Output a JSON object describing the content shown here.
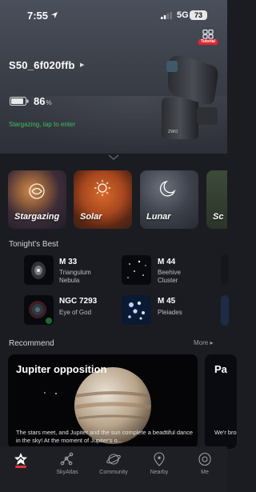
{
  "status_bar": {
    "time": "7:55",
    "network": "5G",
    "battery": "73"
  },
  "header": {
    "tutorial_label": "Tutorial",
    "device_name": "S50_6f020ffb",
    "battery_percent": "86",
    "battery_unit": "%",
    "enter_hint": "Stargazing, tap to enter"
  },
  "modes": [
    {
      "label": "Stargazing"
    },
    {
      "label": "Solar"
    },
    {
      "label": "Lunar"
    },
    {
      "label": "Sc"
    }
  ],
  "tonights_best": {
    "title": "Tonight's Best",
    "objects": [
      {
        "name": "M 33",
        "desc": [
          "Triangulum",
          "Nebula"
        ]
      },
      {
        "name": "M 44",
        "desc": [
          "Beehive",
          "Cluster"
        ]
      },
      {
        "name": "NGC 7293",
        "desc": [
          "Eye of God"
        ]
      },
      {
        "name": "M 45",
        "desc": [
          "Pleiades"
        ]
      }
    ]
  },
  "recommend": {
    "title": "Recommend",
    "more_label": "More",
    "cards": [
      {
        "headline": "Jupiter opposition",
        "body": "The stars meet, and Jupiter and the sun complete a beautiful dance in the sky! At the moment of Jupiter's o..."
      },
      {
        "headline": "Pa",
        "body": "We'r brou"
      }
    ]
  },
  "tabs": [
    {
      "label": ""
    },
    {
      "label": "SkyAtlas"
    },
    {
      "label": "Community"
    },
    {
      "label": "Nearby"
    },
    {
      "label": "Me"
    }
  ],
  "colors": {
    "accent_red": "#e5333a",
    "status_green": "#3fbf5a"
  }
}
